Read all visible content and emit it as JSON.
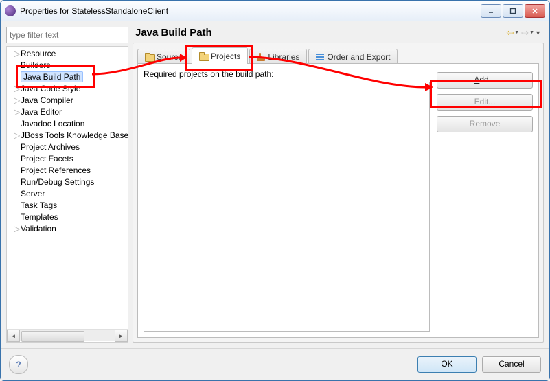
{
  "window": {
    "title": "Properties for StatelessStandaloneClient"
  },
  "filter": {
    "placeholder": "type filter text"
  },
  "tree": [
    {
      "label": "Resource",
      "expandable": true
    },
    {
      "label": "Builders",
      "expandable": false
    },
    {
      "label": "Java Build Path",
      "expandable": false,
      "selected": true
    },
    {
      "label": "Java Code Style",
      "expandable": true
    },
    {
      "label": "Java Compiler",
      "expandable": true
    },
    {
      "label": "Java Editor",
      "expandable": true
    },
    {
      "label": "Javadoc Location",
      "expandable": false
    },
    {
      "label": "JBoss Tools Knowledge Base",
      "expandable": true
    },
    {
      "label": "Project Archives",
      "expandable": false
    },
    {
      "label": "Project Facets",
      "expandable": false
    },
    {
      "label": "Project References",
      "expandable": false
    },
    {
      "label": "Run/Debug Settings",
      "expandable": false
    },
    {
      "label": "Server",
      "expandable": false
    },
    {
      "label": "Task Tags",
      "expandable": false
    },
    {
      "label": "Templates",
      "expandable": false
    },
    {
      "label": "Validation",
      "expandable": true
    }
  ],
  "page": {
    "title": "Java Build Path"
  },
  "tabs": {
    "source": "Source",
    "projects": "Projects",
    "libraries": "Libraries",
    "order": "Order and Export"
  },
  "projects_tab": {
    "required_label": "Required projects on the build path:",
    "buttons": {
      "add": "Add...",
      "edit": "Edit...",
      "remove": "Remove"
    }
  },
  "footer": {
    "ok": "OK",
    "cancel": "Cancel"
  }
}
